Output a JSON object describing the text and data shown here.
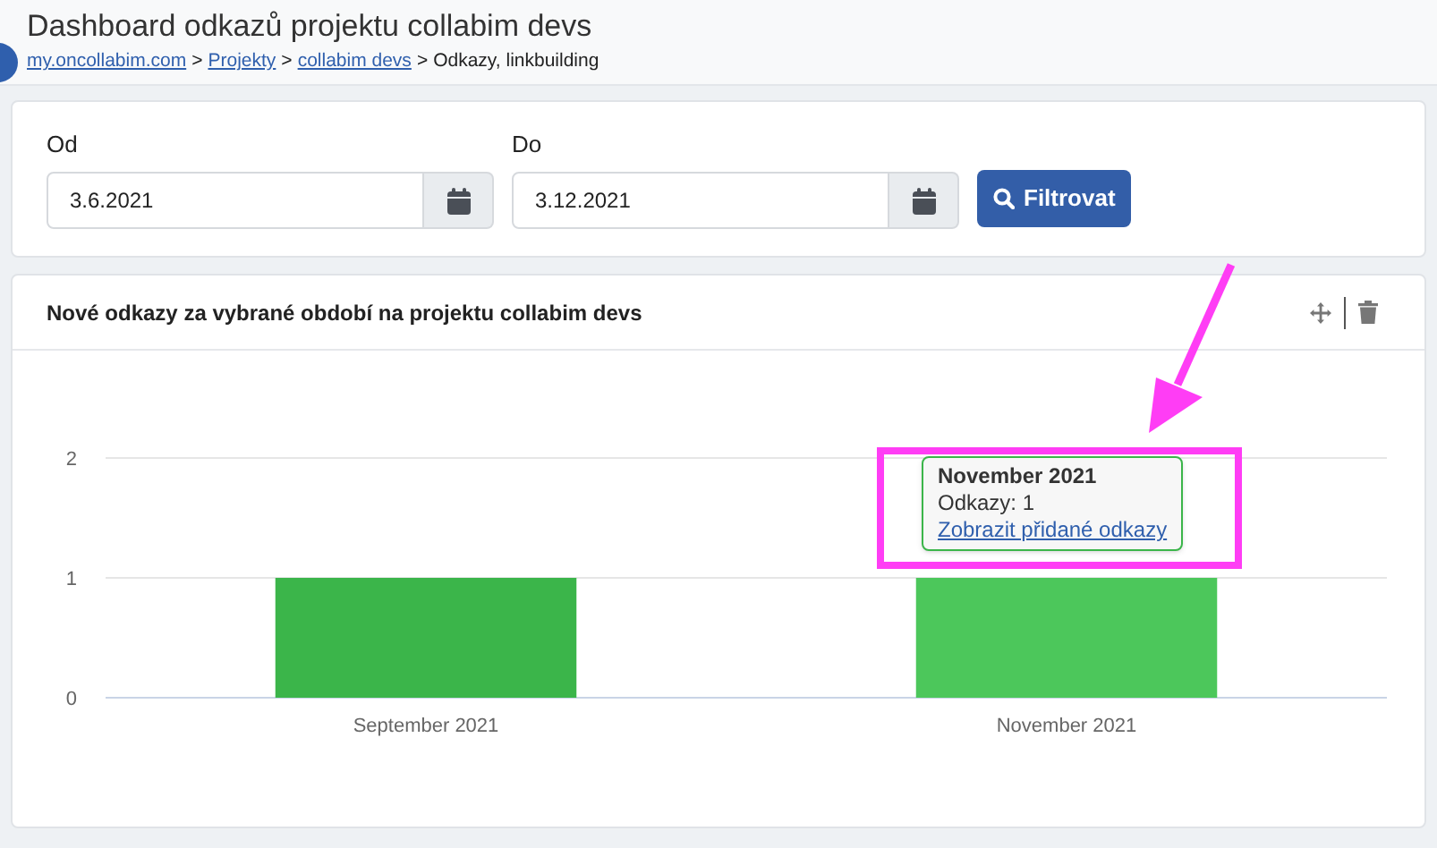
{
  "header": {
    "title": "Dashboard odkazů projektu collabim devs",
    "breadcrumb": [
      {
        "label": "my.oncollabim.com",
        "link": true
      },
      {
        "label": "Projekty",
        "link": true
      },
      {
        "label": "collabim devs",
        "link": true
      },
      {
        "label": "Odkazy, linkbuilding",
        "link": false
      }
    ],
    "separator": ">"
  },
  "filter": {
    "fields": [
      {
        "label": "Od",
        "value": "3.6.2021"
      },
      {
        "label": "Do",
        "value": "3.12.2021"
      }
    ],
    "button": "Filtrovat"
  },
  "chart_card": {
    "title": "Nové odkazy za vybrané období na projektu collabim devs",
    "chart_data": {
      "type": "bar",
      "categories": [
        "September 2021",
        "November 2021"
      ],
      "series": [
        {
          "color": "#3bb54a",
          "values": [
            1,
            1
          ]
        }
      ],
      "ylim": [
        0,
        2
      ],
      "yticks": [
        0,
        1,
        2
      ]
    },
    "tooltip": {
      "title": "November 2021",
      "text": "Odkazy: 1",
      "link": "Zobrazit přidané odkazy"
    }
  }
}
